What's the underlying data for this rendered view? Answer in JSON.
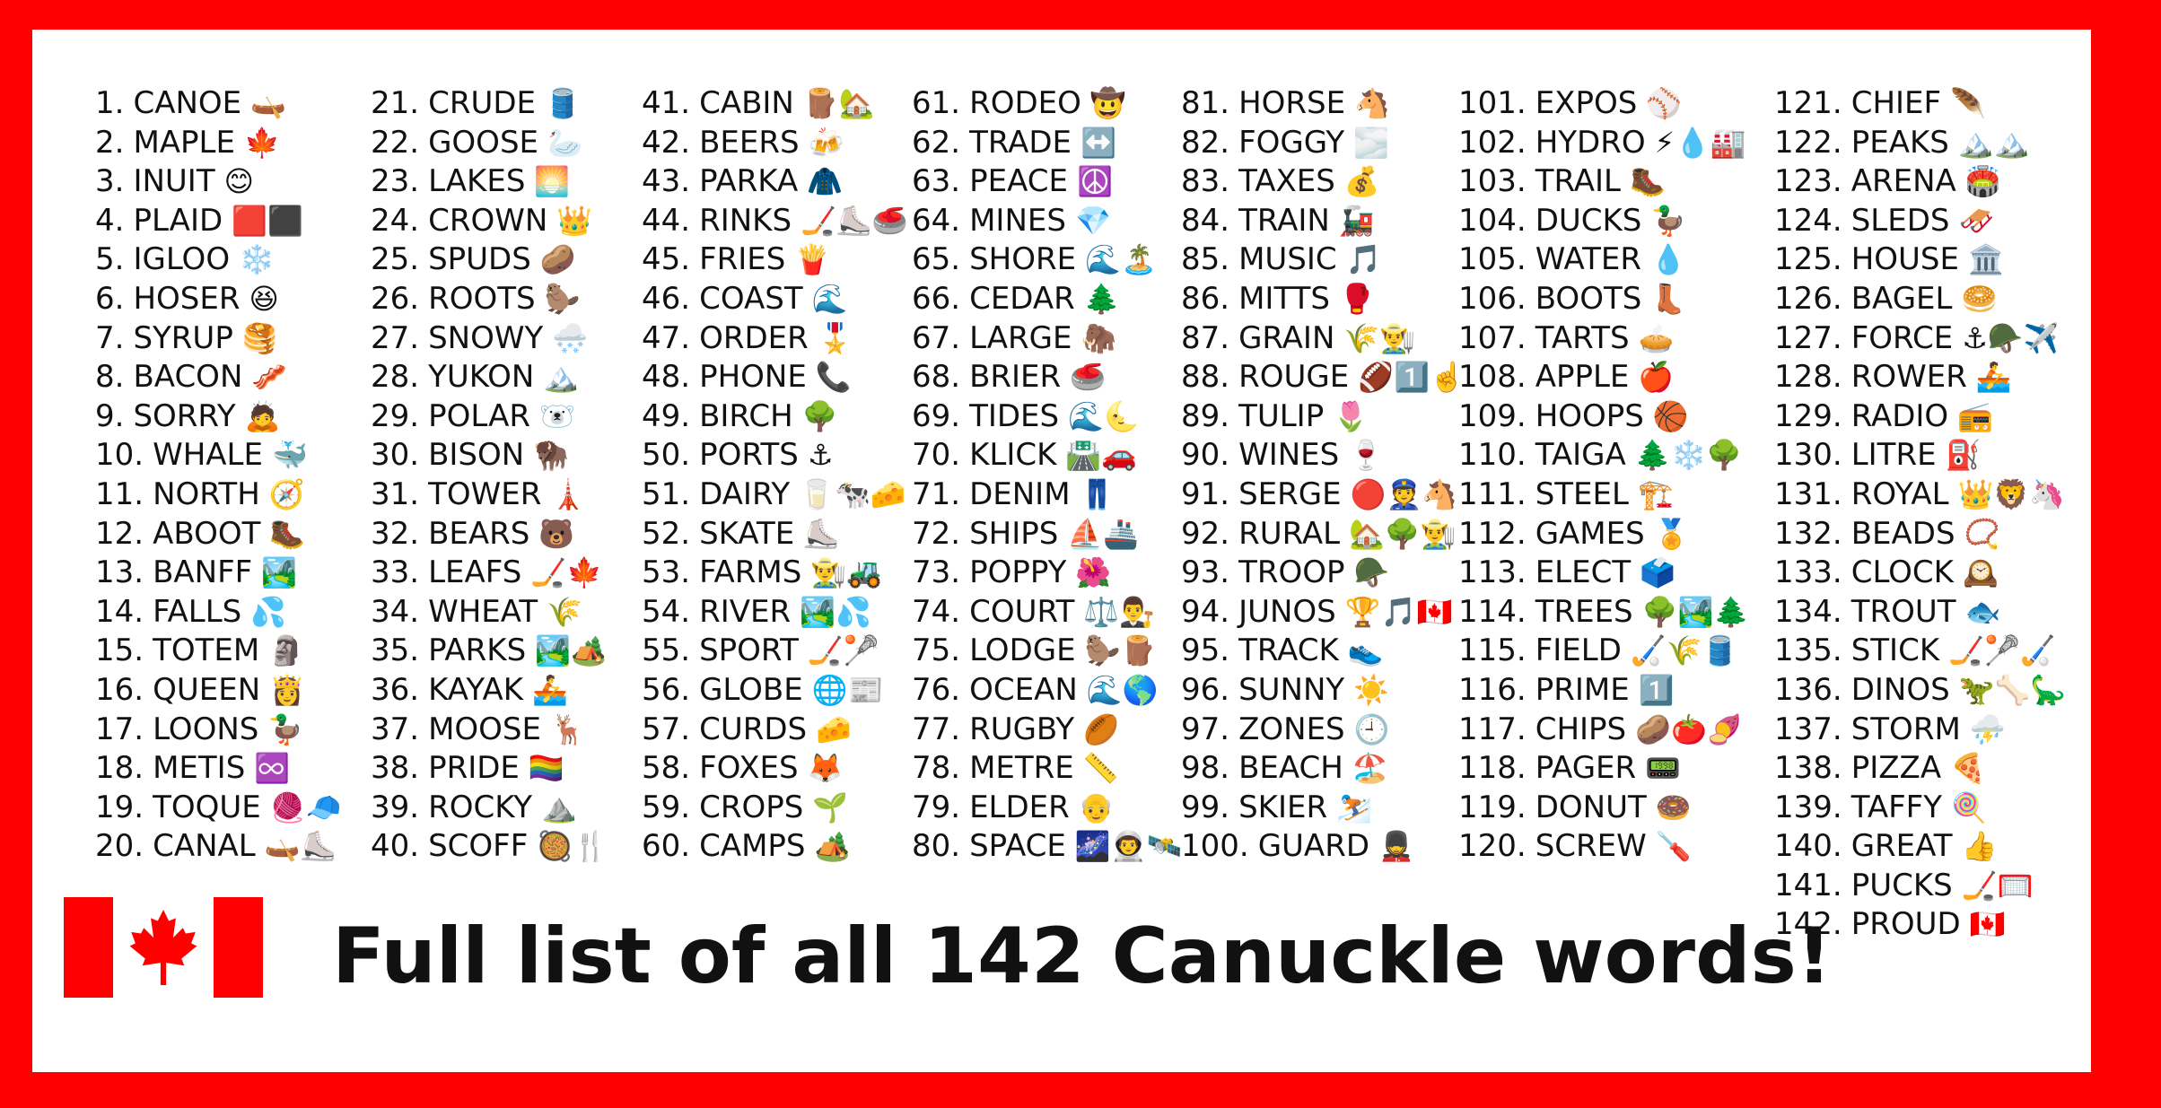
{
  "colors": {
    "background_frame": "#ff0000",
    "panel": "#ffffff",
    "text": "#111111",
    "flag_red": "#ff0000"
  },
  "title": "Full list of all 142 Canuckle words!",
  "columns": [
    [
      {
        "n": "1.",
        "w": "CANOE",
        "e": "🛶"
      },
      {
        "n": "2.",
        "w": "MAPLE",
        "e": "🍁"
      },
      {
        "n": "3.",
        "w": "INUIT",
        "e": "😊"
      },
      {
        "n": "4.",
        "w": "PLAID",
        "e": "🟥⬛"
      },
      {
        "n": "5.",
        "w": "IGLOO",
        "e": "❄️"
      },
      {
        "n": "6.",
        "w": "HOSER",
        "e": "😆"
      },
      {
        "n": "7.",
        "w": "SYRUP",
        "e": "🥞"
      },
      {
        "n": "8.",
        "w": "BACON",
        "e": "🥓"
      },
      {
        "n": "9.",
        "w": "SORRY",
        "e": "🙇"
      },
      {
        "n": "10.",
        "w": "WHALE",
        "e": "🐳"
      },
      {
        "n": "11.",
        "w": "NORTH",
        "e": "🧭"
      },
      {
        "n": "12.",
        "w": "ABOOT",
        "e": "🥾"
      },
      {
        "n": "13.",
        "w": "BANFF",
        "e": "🏞️"
      },
      {
        "n": "14.",
        "w": "FALLS",
        "e": "💦"
      },
      {
        "n": "15.",
        "w": "TOTEM",
        "e": "🗿"
      },
      {
        "n": "16.",
        "w": "QUEEN",
        "e": "👸"
      },
      {
        "n": "17.",
        "w": "LOONS",
        "e": "🦆"
      },
      {
        "n": "18.",
        "w": "METIS",
        "e": "♾️"
      },
      {
        "n": "19.",
        "w": "TOQUE",
        "e": "🧶🧢"
      },
      {
        "n": "20.",
        "w": "CANAL",
        "e": "🛶⛸️"
      }
    ],
    [
      {
        "n": "21.",
        "w": "CRUDE",
        "e": "🛢️"
      },
      {
        "n": "22.",
        "w": "GOOSE",
        "e": "🦢"
      },
      {
        "n": "23.",
        "w": "LAKES",
        "e": "🌅"
      },
      {
        "n": "24.",
        "w": "CROWN",
        "e": "👑"
      },
      {
        "n": "25.",
        "w": "SPUDS",
        "e": "🥔"
      },
      {
        "n": "26.",
        "w": "ROOTS",
        "e": "🦫"
      },
      {
        "n": "27.",
        "w": "SNOWY",
        "e": "🌨️"
      },
      {
        "n": "28.",
        "w": "YUKON",
        "e": "🏔️"
      },
      {
        "n": "29.",
        "w": "POLAR",
        "e": "🐻‍❄️"
      },
      {
        "n": "30.",
        "w": "BISON",
        "e": "🦬"
      },
      {
        "n": "31.",
        "w": "TOWER",
        "e": "🗼"
      },
      {
        "n": "32.",
        "w": "BEARS",
        "e": "🐻"
      },
      {
        "n": "33.",
        "w": "LEAFS",
        "e": "🏒🍁"
      },
      {
        "n": "34.",
        "w": "WHEAT",
        "e": "🌾"
      },
      {
        "n": "35.",
        "w": "PARKS",
        "e": "🏞️🏕️"
      },
      {
        "n": "36.",
        "w": "KAYAK",
        "e": "🚣"
      },
      {
        "n": "37.",
        "w": "MOOSE",
        "e": "🦌"
      },
      {
        "n": "38.",
        "w": "PRIDE",
        "e": "🏳️‍🌈"
      },
      {
        "n": "39.",
        "w": "ROCKY",
        "e": "⛰️"
      },
      {
        "n": "40.",
        "w": "SCOFF",
        "e": "🥘🍴"
      }
    ],
    [
      {
        "n": "41.",
        "w": "CABIN",
        "e": "🪵🏡"
      },
      {
        "n": "42.",
        "w": "BEERS",
        "e": "🍻"
      },
      {
        "n": "43.",
        "w": "PARKA",
        "e": "🧥"
      },
      {
        "n": "44.",
        "w": "RINKS",
        "e": "🏒⛸️🥌"
      },
      {
        "n": "45.",
        "w": "FRIES",
        "e": "🍟"
      },
      {
        "n": "46.",
        "w": "COAST",
        "e": "🌊"
      },
      {
        "n": "47.",
        "w": "ORDER",
        "e": "🎖️"
      },
      {
        "n": "48.",
        "w": "PHONE",
        "e": "📞"
      },
      {
        "n": "49.",
        "w": "BIRCH",
        "e": "🌳"
      },
      {
        "n": "50.",
        "w": "PORTS",
        "e": "⚓"
      },
      {
        "n": "51.",
        "w": "DAIRY",
        "e": "🥛🐄🧀"
      },
      {
        "n": "52.",
        "w": "SKATE",
        "e": "⛸️"
      },
      {
        "n": "53.",
        "w": "FARMS",
        "e": "👨‍🌾🚜"
      },
      {
        "n": "54.",
        "w": "RIVER",
        "e": "🏞️💦"
      },
      {
        "n": "55.",
        "w": "SPORT",
        "e": "🏒🥍"
      },
      {
        "n": "56.",
        "w": "GLOBE",
        "e": "🌐📰"
      },
      {
        "n": "57.",
        "w": "CURDS",
        "e": "🧀"
      },
      {
        "n": "58.",
        "w": "FOXES",
        "e": "🦊"
      },
      {
        "n": "59.",
        "w": "CROPS",
        "e": "🌱"
      },
      {
        "n": "60.",
        "w": "CAMPS",
        "e": "🏕️"
      }
    ],
    [
      {
        "n": "61.",
        "w": "RODEO",
        "e": "🤠"
      },
      {
        "n": "62.",
        "w": "TRADE",
        "e": "↔️"
      },
      {
        "n": "63.",
        "w": "PEACE",
        "e": "☮️"
      },
      {
        "n": "64.",
        "w": "MINES",
        "e": "💎"
      },
      {
        "n": "65.",
        "w": "SHORE",
        "e": "🌊🏝️"
      },
      {
        "n": "66.",
        "w": "CEDAR",
        "e": "🌲"
      },
      {
        "n": "67.",
        "w": "LARGE",
        "e": "🦣"
      },
      {
        "n": "68.",
        "w": "BRIER",
        "e": "🥌"
      },
      {
        "n": "69.",
        "w": "TIDES",
        "e": "🌊🌜"
      },
      {
        "n": "70.",
        "w": "KLICK",
        "e": "🛣️🚗"
      },
      {
        "n": "71.",
        "w": "DENIM",
        "e": "👖"
      },
      {
        "n": "72.",
        "w": "SHIPS",
        "e": "⛵🚢"
      },
      {
        "n": "73.",
        "w": "POPPY",
        "e": "🌺"
      },
      {
        "n": "74.",
        "w": "COURT",
        "e": "⚖️👨‍⚖️"
      },
      {
        "n": "75.",
        "w": "LODGE",
        "e": "🦫🪵"
      },
      {
        "n": "76.",
        "w": "OCEAN",
        "e": "🌊🌎"
      },
      {
        "n": "77.",
        "w": "RUGBY",
        "e": "🏉"
      },
      {
        "n": "78.",
        "w": "METRE",
        "e": "📏"
      },
      {
        "n": "79.",
        "w": "ELDER",
        "e": "👴"
      },
      {
        "n": "80.",
        "w": "SPACE",
        "e": "🌌👨‍🚀🛰️"
      }
    ],
    [
      {
        "n": "81.",
        "w": "HORSE",
        "e": "🐴"
      },
      {
        "n": "82.",
        "w": "FOGGY",
        "e": "🌫️"
      },
      {
        "n": "83.",
        "w": "TAXES",
        "e": "💰"
      },
      {
        "n": "84.",
        "w": "TRAIN",
        "e": "🚂"
      },
      {
        "n": "85.",
        "w": "MUSIC",
        "e": "🎵"
      },
      {
        "n": "86.",
        "w": "MITTS",
        "e": "🥊"
      },
      {
        "n": "87.",
        "w": "GRAIN",
        "e": "🌾👨‍🌾"
      },
      {
        "n": "88.",
        "w": "ROUGE",
        "e": "🏈1️⃣☝️"
      },
      {
        "n": "89.",
        "w": "TULIP",
        "e": "🌷"
      },
      {
        "n": "90.",
        "w": "WINES",
        "e": "🍷"
      },
      {
        "n": "91.",
        "w": "SERGE",
        "e": "🔴👮🐴"
      },
      {
        "n": "92.",
        "w": "RURAL",
        "e": "🏡🌳👨‍🌾"
      },
      {
        "n": "93.",
        "w": "TROOP",
        "e": "🪖"
      },
      {
        "n": "94.",
        "w": "JUNOS",
        "e": "🏆🎵🇨🇦"
      },
      {
        "n": "95.",
        "w": "TRACK",
        "e": "👟"
      },
      {
        "n": "96.",
        "w": "SUNNY",
        "e": "☀️"
      },
      {
        "n": "97.",
        "w": "ZONES",
        "e": "🕘"
      },
      {
        "n": "98.",
        "w": "BEACH",
        "e": "🏖️"
      },
      {
        "n": "99.",
        "w": "SKIER",
        "e": "⛷️"
      },
      {
        "n": "100.",
        "w": "GUARD",
        "e": "💂"
      }
    ],
    [
      {
        "n": "101.",
        "w": "EXPOS",
        "e": "⚾"
      },
      {
        "n": "102.",
        "w": "HYDRO",
        "e": "⚡💧🏭"
      },
      {
        "n": "103.",
        "w": "TRAIL",
        "e": "🥾"
      },
      {
        "n": "104.",
        "w": "DUCKS",
        "e": "🦆"
      },
      {
        "n": "105.",
        "w": "WATER",
        "e": "💧"
      },
      {
        "n": "106.",
        "w": "BOOTS",
        "e": "👢"
      },
      {
        "n": "107.",
        "w": "TARTS",
        "e": "🥧"
      },
      {
        "n": "108.",
        "w": "APPLE",
        "e": "🍎"
      },
      {
        "n": "109.",
        "w": "HOOPS",
        "e": "🏀"
      },
      {
        "n": "110.",
        "w": "TAIGA",
        "e": "🌲❄️🌳"
      },
      {
        "n": "111.",
        "w": "STEEL",
        "e": "🏗️"
      },
      {
        "n": "112.",
        "w": "GAMES",
        "e": "🏅"
      },
      {
        "n": "113.",
        "w": "ELECT",
        "e": "🗳️"
      },
      {
        "n": "114.",
        "w": "TREES",
        "e": "🌳🏞️🌲"
      },
      {
        "n": "115.",
        "w": "FIELD",
        "e": "🏑🌾🛢️"
      },
      {
        "n": "116.",
        "w": "PRIME",
        "e": "1️⃣"
      },
      {
        "n": "117.",
        "w": "CHIPS",
        "e": "🥔🍅🍠"
      },
      {
        "n": "118.",
        "w": "PAGER",
        "e": "📟"
      },
      {
        "n": "119.",
        "w": "DONUT",
        "e": "🍩"
      },
      {
        "n": "120.",
        "w": "SCREW",
        "e": "🪛"
      }
    ],
    [
      {
        "n": "121.",
        "w": "CHIEF",
        "e": "🪶"
      },
      {
        "n": "122.",
        "w": "PEAKS",
        "e": "🏔️🏔️"
      },
      {
        "n": "123.",
        "w": "ARENA",
        "e": "🏟️"
      },
      {
        "n": "124.",
        "w": "SLEDS",
        "e": "🛷"
      },
      {
        "n": "125.",
        "w": "HOUSE",
        "e": "🏛️"
      },
      {
        "n": "126.",
        "w": "BAGEL",
        "e": "🥯"
      },
      {
        "n": "127.",
        "w": "FORCE",
        "e": "⚓🪖✈️"
      },
      {
        "n": "128.",
        "w": "ROWER",
        "e": "🚣"
      },
      {
        "n": "129.",
        "w": "RADIO",
        "e": "📻"
      },
      {
        "n": "130.",
        "w": "LITRE",
        "e": "⛽"
      },
      {
        "n": "131.",
        "w": "ROYAL",
        "e": "👑🦁🦄"
      },
      {
        "n": "132.",
        "w": "BEADS",
        "e": "📿"
      },
      {
        "n": "133.",
        "w": "CLOCK",
        "e": "🕰️"
      },
      {
        "n": "134.",
        "w": "TROUT",
        "e": "🐟"
      },
      {
        "n": "135.",
        "w": "STICK",
        "e": "🏒🥍🏑"
      },
      {
        "n": "136.",
        "w": "DINOS",
        "e": "🦖🦴🦕"
      },
      {
        "n": "137.",
        "w": "STORM",
        "e": "⛈️"
      },
      {
        "n": "138.",
        "w": "PIZZA",
        "e": "🍕"
      },
      {
        "n": "139.",
        "w": "TAFFY",
        "e": "🍭"
      },
      {
        "n": "140.",
        "w": "GREAT",
        "e": "👍"
      },
      {
        "n": "141.",
        "w": "PUCKS",
        "e": "🏒🥅"
      },
      {
        "n": "142.",
        "w": "PROUD",
        "e": "🇨🇦"
      }
    ]
  ]
}
